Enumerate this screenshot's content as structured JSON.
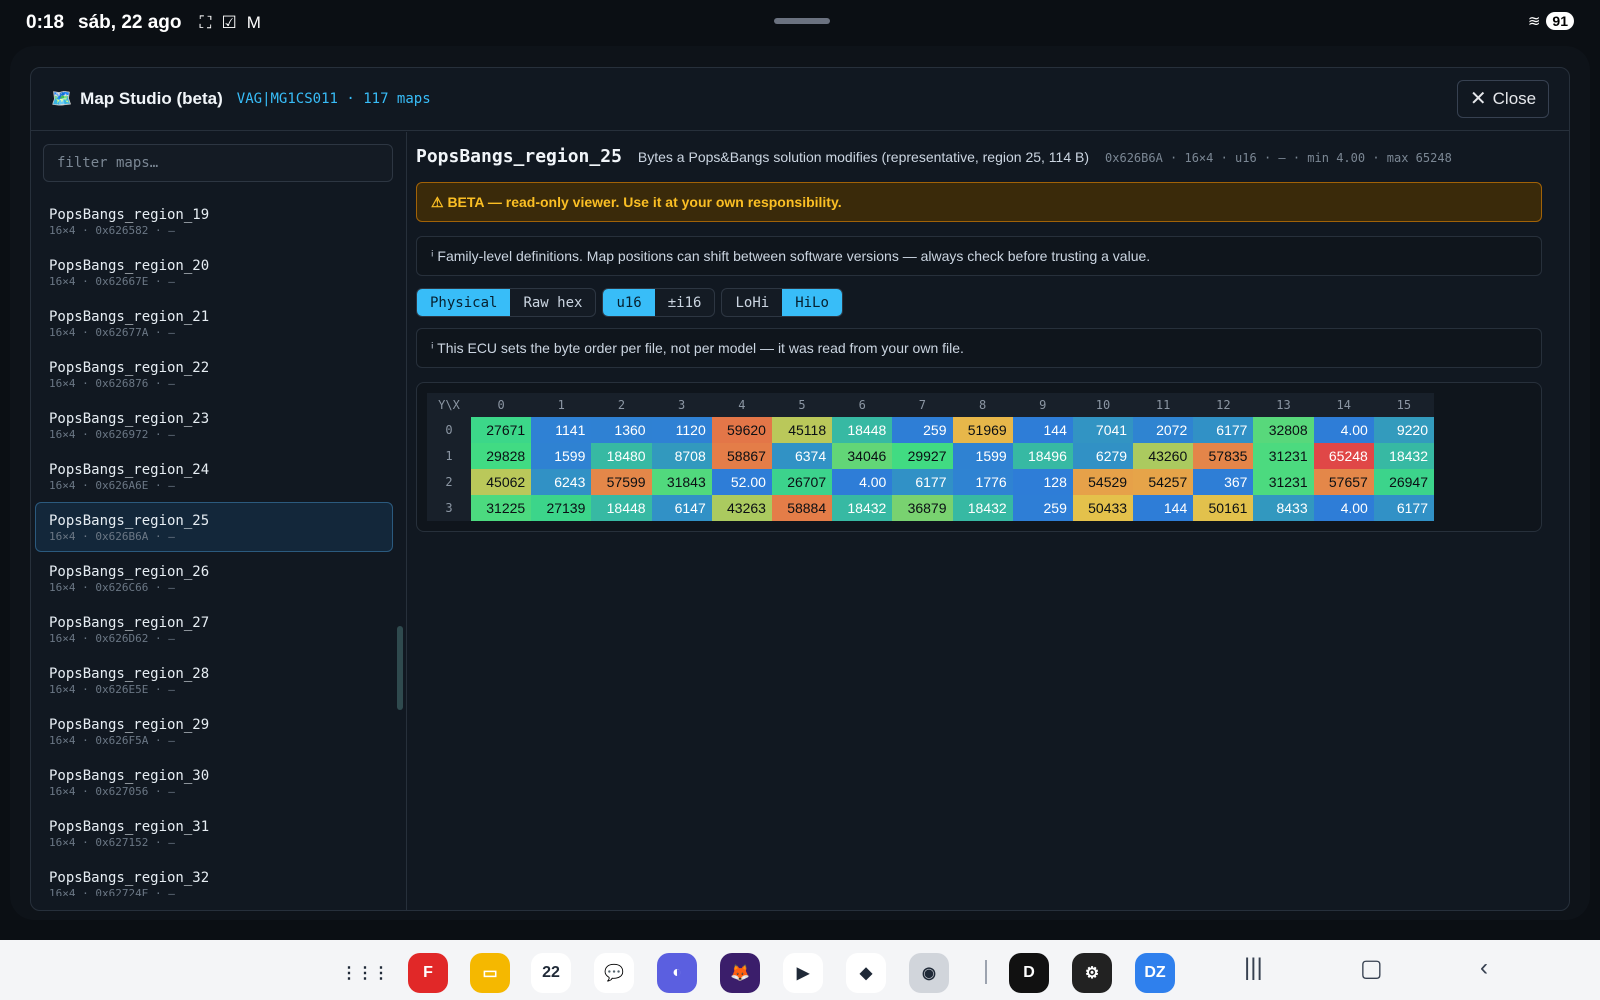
{
  "status_bar": {
    "time": "0:18",
    "date": "sáb, 22 ago",
    "battery": "91",
    "icons": [
      "screenshot-icon",
      "checkbox-icon",
      "gmail-icon",
      "wifi-icon"
    ]
  },
  "modal": {
    "icon": "🗺️",
    "title": "Map Studio (beta)",
    "subtitle": "VAG|MG1CS011 · 117 maps",
    "close_label": "Close"
  },
  "sidebar": {
    "filter_placeholder": "filter maps…",
    "items": [
      {
        "name": "PopsBangs_region_19",
        "meta": "16×4 · 0x626582 · —"
      },
      {
        "name": "PopsBangs_region_20",
        "meta": "16×4 · 0x62667E · —"
      },
      {
        "name": "PopsBangs_region_21",
        "meta": "16×4 · 0x62677A · —"
      },
      {
        "name": "PopsBangs_region_22",
        "meta": "16×4 · 0x626876 · —"
      },
      {
        "name": "PopsBangs_region_23",
        "meta": "16×4 · 0x626972 · —"
      },
      {
        "name": "PopsBangs_region_24",
        "meta": "16×4 · 0x626A6E · —"
      },
      {
        "name": "PopsBangs_region_25",
        "meta": "16×4 · 0x626B6A · —"
      },
      {
        "name": "PopsBangs_region_26",
        "meta": "16×4 · 0x626C66 · —"
      },
      {
        "name": "PopsBangs_region_27",
        "meta": "16×4 · 0x626D62 · —"
      },
      {
        "name": "PopsBangs_region_28",
        "meta": "16×4 · 0x626E5E · —"
      },
      {
        "name": "PopsBangs_region_29",
        "meta": "16×4 · 0x626F5A · —"
      },
      {
        "name": "PopsBangs_region_30",
        "meta": "16×4 · 0x627056 · —"
      },
      {
        "name": "PopsBangs_region_31",
        "meta": "16×4 · 0x627152 · —"
      },
      {
        "name": "PopsBangs_region_32",
        "meta": "16×4 · 0x62724E · —"
      }
    ]
  },
  "map": {
    "name": "PopsBangs_region_25",
    "description": "Bytes a Pops&Bangs solution modifies (representative, region 25, 114 B)",
    "meta": "0x626B6A · 16×4 · u16 · — · min 4.00 · max 65248",
    "warning": "⚠ BETA — read-only viewer. Use it at your own responsibility.",
    "info_family": "ⁱ Family-level definitions. Map positions can shift between software versions — always check before trusting a value.",
    "info_byteorder": "ⁱ This ECU sets the byte order per file, not per model — it was read from your own file.",
    "toggle_groups": [
      [
        {
          "label": "Physical",
          "on": true
        },
        {
          "label": "Raw hex",
          "on": false
        }
      ],
      [
        {
          "label": "u16",
          "on": true
        },
        {
          "label": "±i16",
          "on": false
        }
      ],
      [
        {
          "label": "LoHi",
          "on": false
        },
        {
          "label": "HiLo",
          "on": true
        }
      ]
    ],
    "corner_label": "Y\\X",
    "x_axis": [
      "0",
      "1",
      "2",
      "3",
      "4",
      "5",
      "6",
      "7",
      "8",
      "9",
      "10",
      "11",
      "12",
      "13",
      "14",
      "15"
    ],
    "y_axis": [
      "0",
      "1",
      "2",
      "3"
    ],
    "cells": [
      [
        "27671",
        "1141",
        "1360",
        "1120",
        "59620",
        "45118",
        "18448",
        "259",
        "51969",
        "144",
        "7041",
        "2072",
        "6177",
        "32808",
        "4.00",
        "9220"
      ],
      [
        "29828",
        "1599",
        "18480",
        "8708",
        "58867",
        "6374",
        "34046",
        "29927",
        "1599",
        "18496",
        "6279",
        "43260",
        "57835",
        "31231",
        "65248",
        "18432"
      ],
      [
        "45062",
        "6243",
        "57599",
        "31843",
        "52.00",
        "26707",
        "4.00",
        "6177",
        "1776",
        "128",
        "54529",
        "54257",
        "367",
        "31231",
        "57657",
        "26947"
      ],
      [
        "31225",
        "27139",
        "18448",
        "6147",
        "43263",
        "58884",
        "18432",
        "36879",
        "18432",
        "259",
        "50433",
        "144",
        "50161",
        "8433",
        "4.00",
        "6177"
      ]
    ],
    "colors": {
      "min": "#2e7dd7",
      "mid": "#3ddc84",
      "high": "#e8c04a",
      "max": "#e04747"
    },
    "value_range": [
      4,
      65248
    ]
  },
  "dock": {
    "apps": [
      {
        "name": "apps-grid-icon",
        "color": "#f4f5f7",
        "glyph": "⋮⋮⋮"
      },
      {
        "name": "flipboard-icon",
        "color": "#e12828",
        "glyph": "F"
      },
      {
        "name": "files-icon",
        "color": "#f5b800",
        "glyph": "▭"
      },
      {
        "name": "calendar-icon",
        "color": "#ffffff",
        "glyph": "22"
      },
      {
        "name": "messages-icon",
        "color": "#ffffff",
        "glyph": "💬"
      },
      {
        "name": "browser-icon",
        "color": "#5b5fe0",
        "glyph": "◐"
      },
      {
        "name": "firefox-icon",
        "color": "#3b1e6b",
        "glyph": "🦊"
      },
      {
        "name": "youtube-icon",
        "color": "#ffffff",
        "glyph": "▶"
      },
      {
        "name": "gemini-icon",
        "color": "#ffffff",
        "glyph": "◆"
      },
      {
        "name": "camera-icon",
        "color": "#d1d5db",
        "glyph": "◉"
      },
      {
        "name": "davinci-icon",
        "color": "#111111",
        "glyph": "D"
      },
      {
        "name": "settings-icon",
        "color": "#222222",
        "glyph": "⚙"
      },
      {
        "name": "dz-icon",
        "color": "#2f80ed",
        "glyph": "DZ"
      }
    ],
    "nav": [
      "|||",
      "▢",
      "‹"
    ]
  }
}
